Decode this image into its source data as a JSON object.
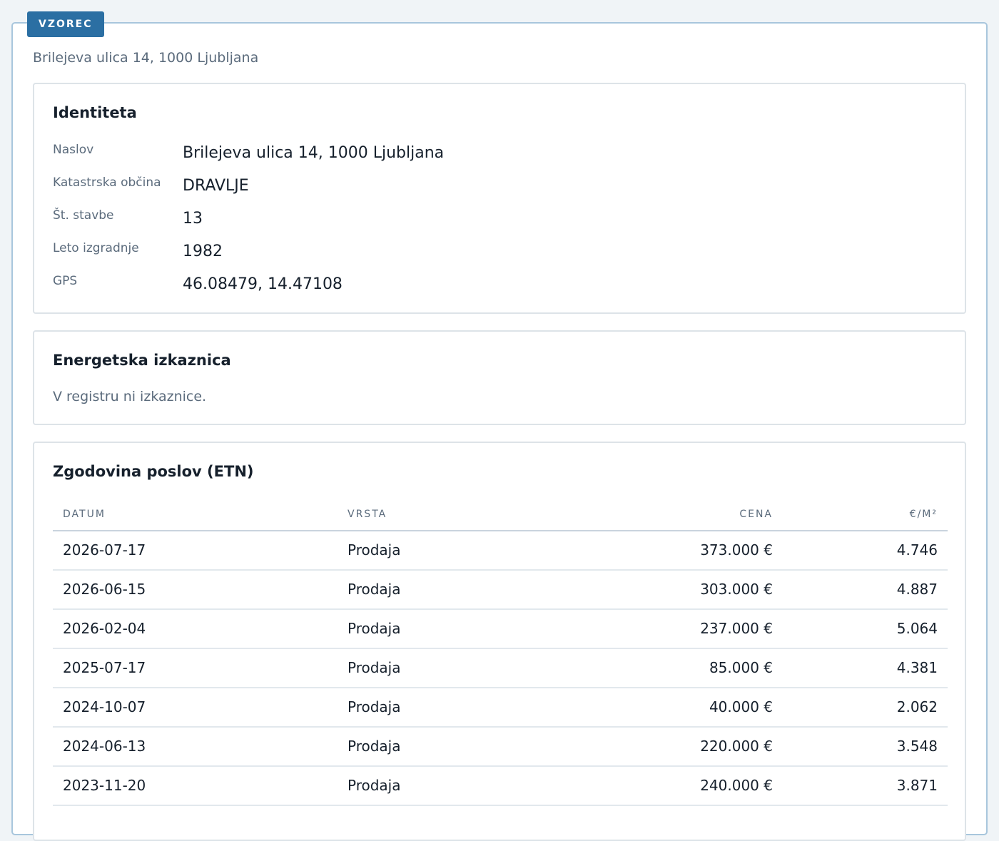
{
  "badge": "VZOREC",
  "subtitle": "Brilejeva ulica 14, 1000 Ljubljana",
  "identity": {
    "title": "Identiteta",
    "rows": [
      {
        "label": "Naslov",
        "value": "Brilejeva ulica 14, 1000 Ljubljana"
      },
      {
        "label": "Katastrska občina",
        "value": "DRAVLJE"
      },
      {
        "label": "Št. stavbe",
        "value": "13"
      },
      {
        "label": "Leto izgradnje",
        "value": "1982"
      },
      {
        "label": "GPS",
        "value": "46.08479, 14.47108"
      }
    ]
  },
  "energy": {
    "title": "Energetska izkaznica",
    "note": "V registru ni izkaznice."
  },
  "history": {
    "title": "Zgodovina poslov (ETN)",
    "columns": [
      "DATUM",
      "VRSTA",
      "CENA",
      "€/M²"
    ],
    "rows": [
      [
        "2026-07-17",
        "Prodaja",
        "373.000 €",
        "4.746"
      ],
      [
        "2026-06-15",
        "Prodaja",
        "303.000 €",
        "4.887"
      ],
      [
        "2026-02-04",
        "Prodaja",
        "237.000 €",
        "5.064"
      ],
      [
        "2025-07-17",
        "Prodaja",
        "85.000 €",
        "4.381"
      ],
      [
        "2024-10-07",
        "Prodaja",
        "40.000 €",
        "2.062"
      ],
      [
        "2024-06-13",
        "Prodaja",
        "220.000 €",
        "3.548"
      ],
      [
        "2023-11-20",
        "Prodaja",
        "240.000 €",
        "3.871"
      ]
    ]
  }
}
